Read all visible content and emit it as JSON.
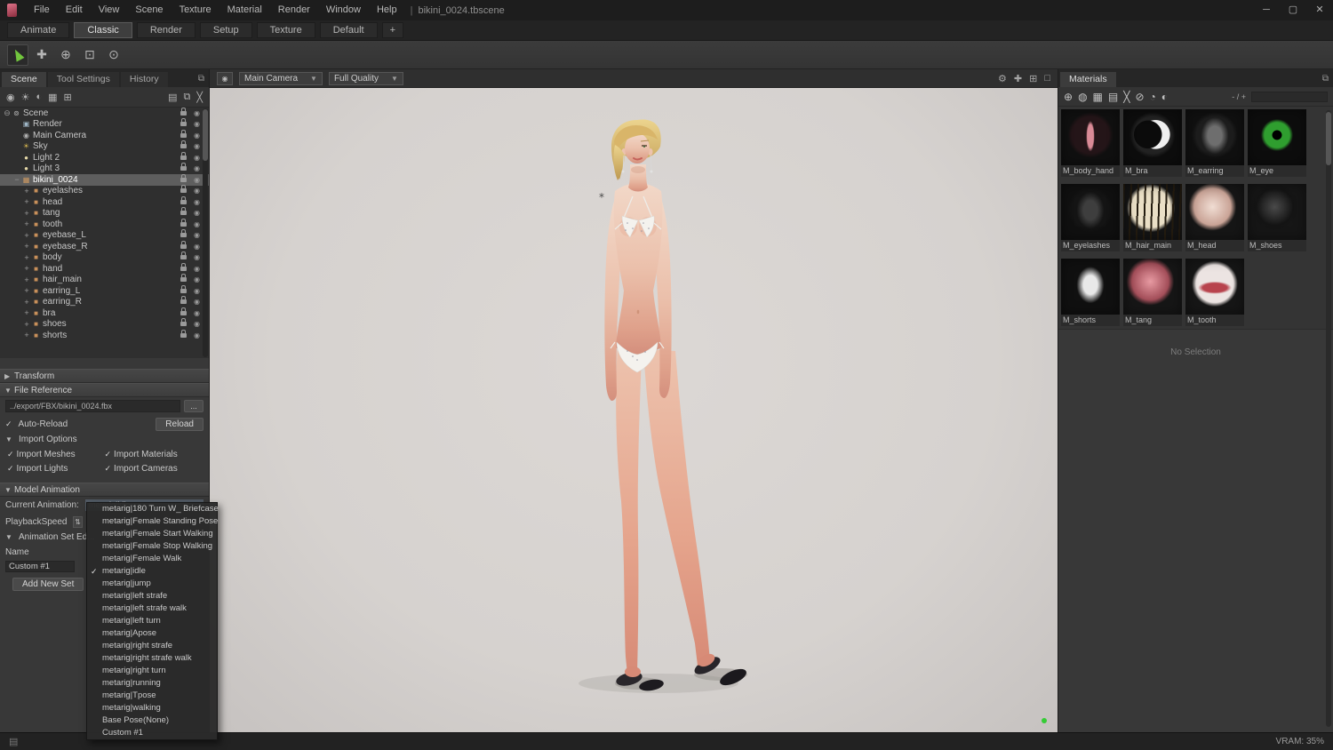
{
  "menubar": {
    "menus": [
      "File",
      "Edit",
      "View",
      "Scene",
      "Texture",
      "Material",
      "Render",
      "Window",
      "Help"
    ],
    "separator": "|",
    "title": "bikini_0024.tbscene"
  },
  "tabbar": {
    "tabs": [
      {
        "label": "Animate",
        "active": false
      },
      {
        "label": "Classic",
        "active": true
      },
      {
        "label": "Render",
        "active": false
      },
      {
        "label": "Setup",
        "active": false
      },
      {
        "label": "Texture",
        "active": false
      },
      {
        "label": "Default",
        "active": false
      },
      {
        "label": "+",
        "active": false
      }
    ]
  },
  "toolbar": {
    "tools": [
      "select-tool",
      "move-tool",
      "rotate-tool",
      "scale-tool",
      "camera-tool"
    ]
  },
  "left_panel": {
    "tabs": [
      {
        "label": "Scene",
        "active": true
      },
      {
        "label": "Tool Settings",
        "active": false
      },
      {
        "label": "History",
        "active": false
      }
    ],
    "toolbar_icons": [
      "add-camera",
      "add-light",
      "add-sky",
      "add-object",
      "import"
    ],
    "toolbar_icons_right": [
      "folder",
      "duplicate",
      "delete"
    ],
    "tree": [
      {
        "label": "Scene",
        "depth": 0,
        "icon": "scene",
        "expander": "minus-circle"
      },
      {
        "label": "Render",
        "depth": 1,
        "icon": "render",
        "expander": ""
      },
      {
        "label": "Main Camera",
        "depth": 1,
        "icon": "camera",
        "expander": ""
      },
      {
        "label": "Sky",
        "depth": 1,
        "icon": "sky",
        "expander": ""
      },
      {
        "label": "Light 2",
        "depth": 1,
        "icon": "light",
        "expander": ""
      },
      {
        "label": "Light 3",
        "depth": 1,
        "icon": "light",
        "expander": ""
      },
      {
        "label": "bikini_0024",
        "depth": 1,
        "icon": "model",
        "expander": "minus",
        "selected": true
      },
      {
        "label": "eyelashes",
        "depth": 2,
        "icon": "mesh",
        "expander": "plus"
      },
      {
        "label": "head",
        "depth": 2,
        "icon": "mesh",
        "expander": "plus"
      },
      {
        "label": "tang",
        "depth": 2,
        "icon": "mesh",
        "expander": "plus"
      },
      {
        "label": "tooth",
        "depth": 2,
        "icon": "mesh",
        "expander": "plus"
      },
      {
        "label": "eyebase_L",
        "depth": 2,
        "icon": "mesh",
        "expander": "plus"
      },
      {
        "label": "eyebase_R",
        "depth": 2,
        "icon": "mesh",
        "expander": "plus"
      },
      {
        "label": "body",
        "depth": 2,
        "icon": "mesh",
        "expander": "plus"
      },
      {
        "label": "hand",
        "depth": 2,
        "icon": "mesh",
        "expander": "plus"
      },
      {
        "label": "hair_main",
        "depth": 2,
        "icon": "mesh",
        "expander": "plus"
      },
      {
        "label": "earring_L",
        "depth": 2,
        "icon": "mesh",
        "expander": "plus"
      },
      {
        "label": "earring_R",
        "depth": 2,
        "icon": "mesh",
        "expander": "plus"
      },
      {
        "label": "bra",
        "depth": 2,
        "icon": "mesh",
        "expander": "plus"
      },
      {
        "label": "shoes",
        "depth": 2,
        "icon": "mesh",
        "expander": "plus"
      },
      {
        "label": "shorts",
        "depth": 2,
        "icon": "mesh",
        "expander": "plus"
      }
    ]
  },
  "properties": {
    "transform_header": "Transform",
    "file_reference": {
      "header": "File Reference",
      "path": "../export/FBX/bikini_0024.fbx",
      "browse_label": "...",
      "auto_reload_label": "Auto-Reload",
      "reload_label": "Reload",
      "import_options_header": "Import Options",
      "options": [
        "Import Meshes",
        "Import Materials",
        "Import Lights",
        "Import Cameras"
      ]
    },
    "model_animation": {
      "header": "Model Animation",
      "current_label": "Current Animation:",
      "current_value": "metarig|idle",
      "playback_label": "PlaybackSpeed",
      "anim_set_header": "Animation Set Ed...",
      "name_label": "Name",
      "set_name": "Custom #1",
      "add_button_label": "Add New Set"
    }
  },
  "dropdown": {
    "items": [
      {
        "label": "metarig|180 Turn W_ Briefcase",
        "checked": false
      },
      {
        "label": "metarig|Female Standing Pose",
        "checked": false
      },
      {
        "label": "metarig|Female Start Walking",
        "checked": false
      },
      {
        "label": "metarig|Female Stop Walking",
        "checked": false
      },
      {
        "label": "metarig|Female Walk",
        "checked": false
      },
      {
        "label": "metarig|idle",
        "checked": true
      },
      {
        "label": "metarig|jump",
        "checked": false
      },
      {
        "label": "metarig|left strafe",
        "checked": false
      },
      {
        "label": "metarig|left strafe walk",
        "checked": false
      },
      {
        "label": "metarig|left turn",
        "checked": false
      },
      {
        "label": "metarig|Apose",
        "checked": false
      },
      {
        "label": "metarig|right strafe",
        "checked": false
      },
      {
        "label": "metarig|right strafe walk",
        "checked": false
      },
      {
        "label": "metarig|right turn",
        "checked": false
      },
      {
        "label": "metarig|running",
        "checked": false
      },
      {
        "label": "metarig|Tpose",
        "checked": false
      },
      {
        "label": "metarig|walking",
        "checked": false
      },
      {
        "label": "Base Pose(None)",
        "checked": false
      },
      {
        "label": "Custom #1",
        "checked": false
      }
    ]
  },
  "viewport": {
    "camera_select": "Main Camera",
    "quality_select": "Full Quality",
    "icons": [
      "gear",
      "pan",
      "split",
      "maximize"
    ],
    "background": "#d6d2cf"
  },
  "materials_panel": {
    "tab": "Materials",
    "toolbar_icons": [
      "add-material",
      "preview-sphere",
      "checker",
      "folder",
      "delete",
      "mask",
      "clock",
      "globe"
    ],
    "zoom_label": "- / +",
    "materials": [
      {
        "name": "M_body_hand",
        "style": "slit",
        "colors": [
          "#241518",
          "#d98a96"
        ]
      },
      {
        "name": "M_bra",
        "style": "crescent",
        "colors": [
          "#0d0d0d",
          "#efefef"
        ]
      },
      {
        "name": "M_earring",
        "style": "wisp",
        "colors": [
          "#1d1d1d",
          "#6e6e6e"
        ]
      },
      {
        "name": "M_eye",
        "style": "iris",
        "colors": [
          "#101010",
          "#2f9e2f"
        ]
      },
      {
        "name": "M_eyelashes",
        "style": "wisp",
        "colors": [
          "#141414",
          "#3e3e3e"
        ]
      },
      {
        "name": "M_hair_main",
        "style": "stripes",
        "colors": [
          "#eadfc6",
          "#241c10"
        ]
      },
      {
        "name": "M_head",
        "style": "sphere",
        "colors": [
          "#f0ddd3",
          "#c9a396"
        ]
      },
      {
        "name": "M_shoes",
        "style": "sphere",
        "colors": [
          "#4a4a4a",
          "#141414"
        ]
      },
      {
        "name": "M_shorts",
        "style": "wisp",
        "colors": [
          "#101010",
          "#e8e8e8"
        ]
      },
      {
        "name": "M_tang",
        "style": "sphere",
        "colors": [
          "#e79aa2",
          "#a34e59"
        ]
      },
      {
        "name": "M_tooth",
        "style": "lips",
        "colors": [
          "#ece4e2",
          "#b8434d"
        ]
      }
    ],
    "no_selection": "No Selection"
  },
  "statusbar": {
    "vram": "VRAM: 35%"
  }
}
